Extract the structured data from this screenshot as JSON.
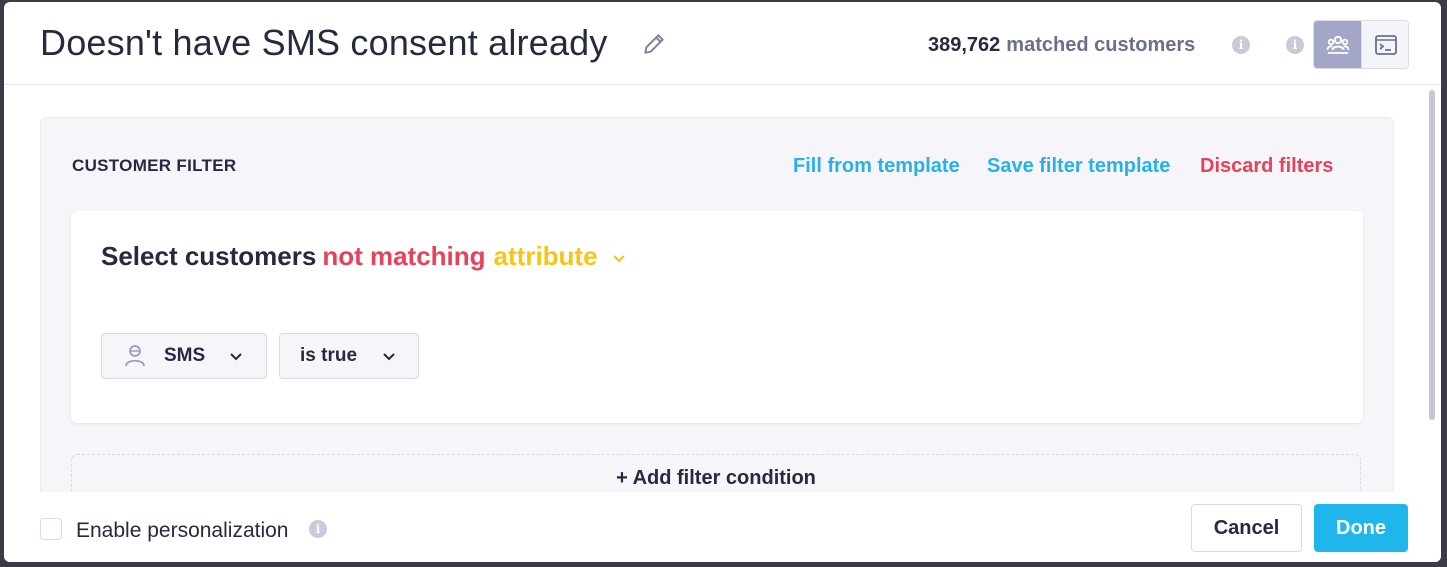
{
  "header": {
    "title": "Doesn't have SMS consent already",
    "matched_count": "389,762",
    "matched_label": "matched customers"
  },
  "filter": {
    "section_title": "CUSTOMER FILTER",
    "actions": {
      "fill_template": "Fill from template",
      "save_template": "Save filter template",
      "discard": "Discard filters"
    },
    "select_prefix": "Select customers",
    "matching_mode": "not matching",
    "filter_type": "attribute",
    "condition": {
      "attribute": "SMS",
      "operator": "is true"
    },
    "add_condition": "+ Add filter condition"
  },
  "footer": {
    "personalization_label": "Enable personalization",
    "personalization_checked": false,
    "cancel_label": "Cancel",
    "done_label": "Done"
  },
  "colors": {
    "link_blue": "#2ab0e8",
    "danger_red": "#e8415c",
    "attribute_yellow": "#f5c518",
    "primary_button": "#1fb6ec",
    "text_dark": "#262a3f",
    "text_muted": "#6b6f8e"
  },
  "icons": {
    "edit": "pencil-icon",
    "info": "info-icon",
    "customers_view": "customers-icon",
    "code_view": "terminal-icon",
    "attribute_type": "user-icon",
    "chevron": "chevron-down-icon"
  }
}
